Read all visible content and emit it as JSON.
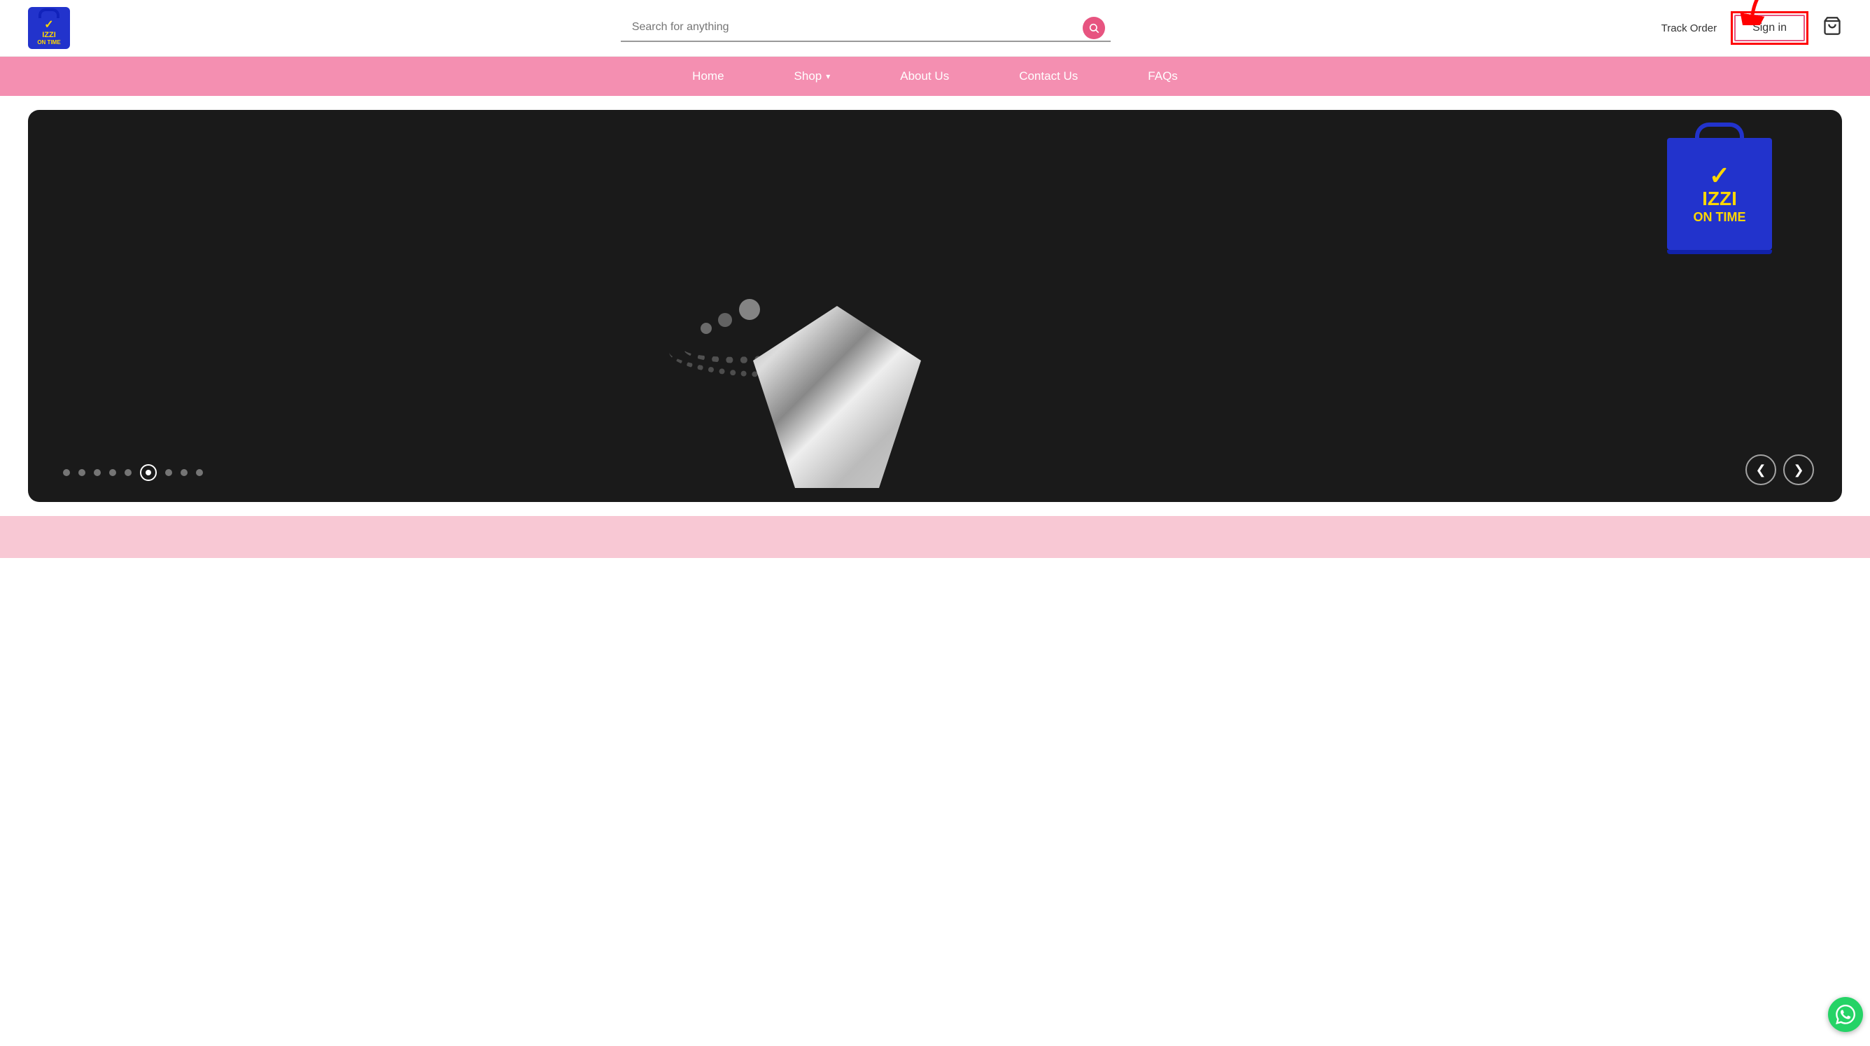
{
  "header": {
    "logo": {
      "brand_name": "IZZI ON TIME",
      "check_symbol": "✓",
      "line1": "IZZI",
      "line2": "ON TIME"
    },
    "search": {
      "placeholder": "Search for anything"
    },
    "track_order_label": "Track Order",
    "signin_label": "Sign in",
    "cart_icon_label": "cart"
  },
  "navbar": {
    "items": [
      {
        "label": "Home",
        "has_dropdown": false
      },
      {
        "label": "Shop",
        "has_dropdown": true
      },
      {
        "label": "About Us",
        "has_dropdown": false
      },
      {
        "label": "Contact Us",
        "has_dropdown": false
      },
      {
        "label": "FAQs",
        "has_dropdown": false
      }
    ]
  },
  "hero": {
    "brand_check": "✓",
    "brand_line1": "IZZI",
    "brand_line2": "ON TIME",
    "slider_dots_count": 9,
    "active_dot_index": 5,
    "prev_arrow": "❮",
    "next_arrow": "❯"
  },
  "bottom_section": {
    "background_color": "#f8c8d4"
  },
  "whatsapp": {
    "icon": "💬"
  }
}
